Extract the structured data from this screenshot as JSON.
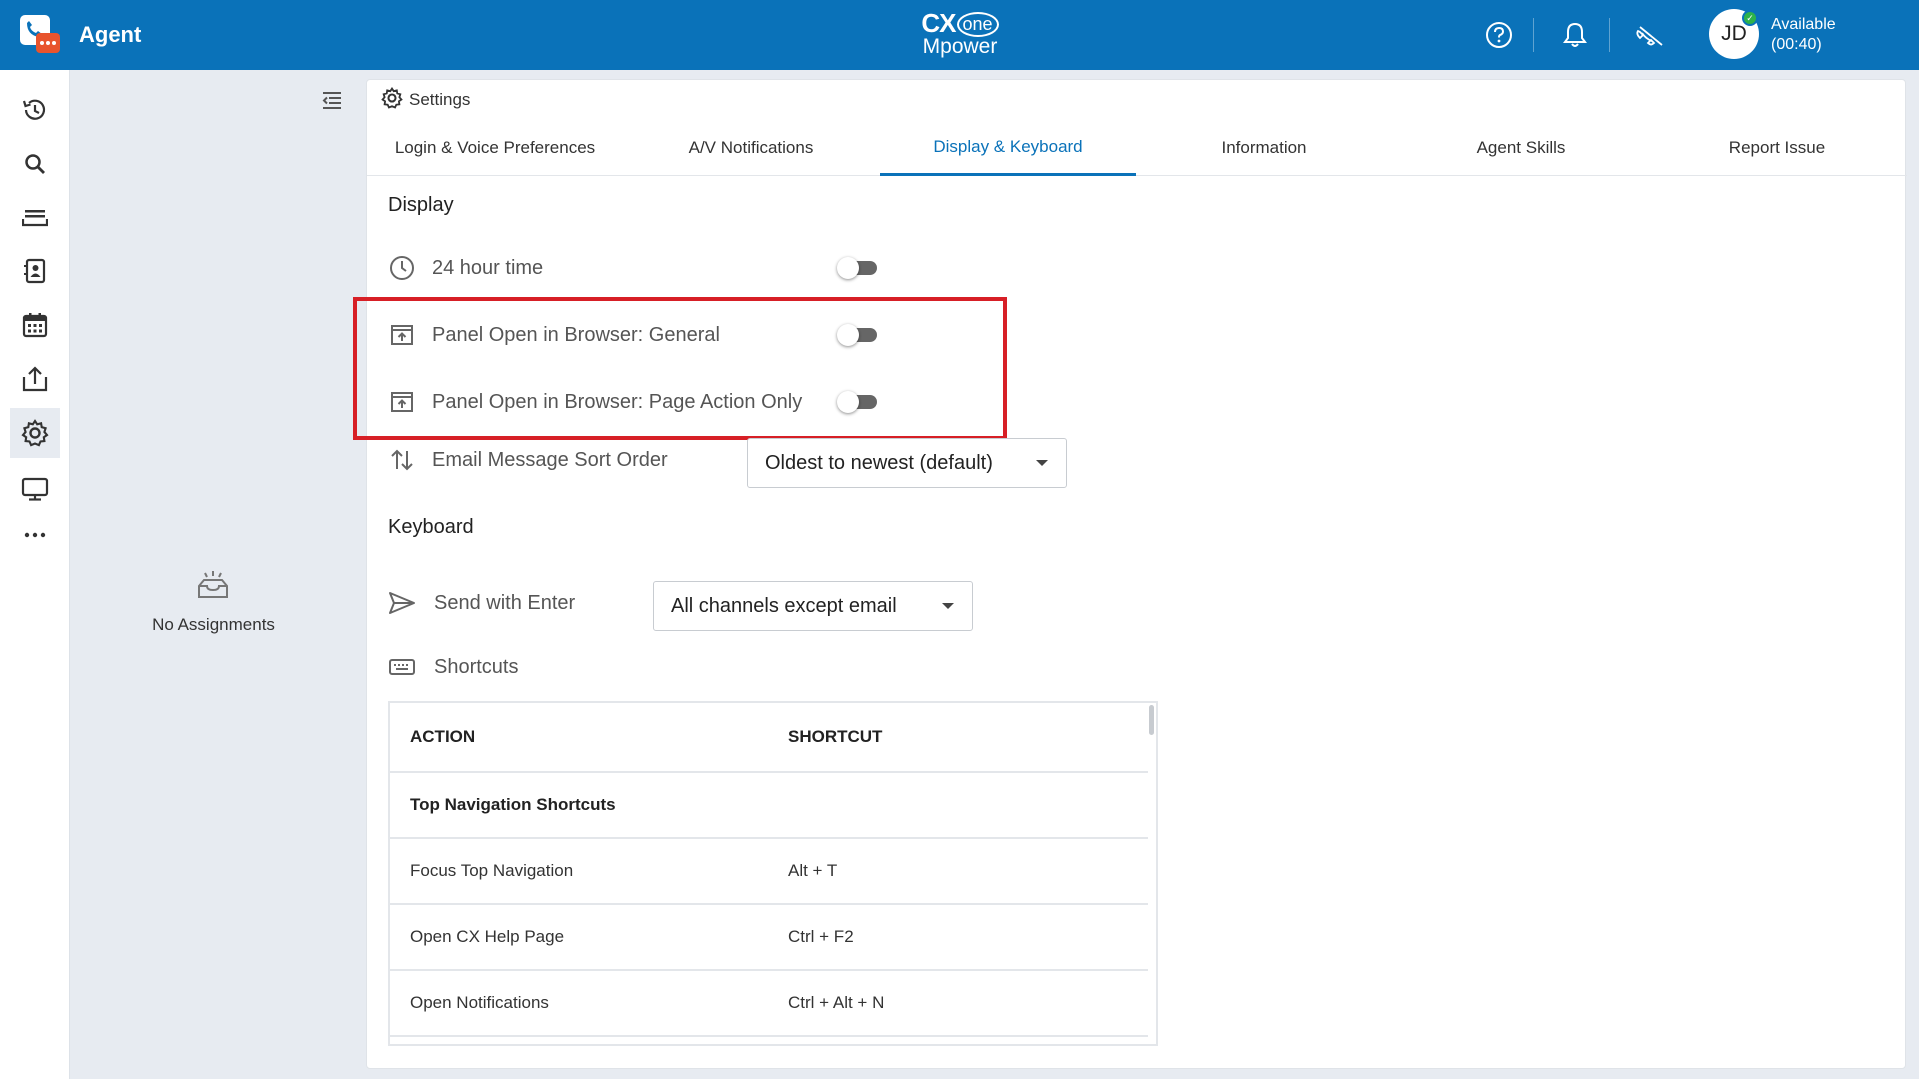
{
  "header": {
    "app_title": "Agent",
    "brand_cx": "CX",
    "brand_one": "one",
    "brand_mpower": "Mpower",
    "user_initials": "JD",
    "status_label": "Available",
    "status_timer": "(00:40)"
  },
  "assignments": {
    "empty_label": "No Assignments"
  },
  "settings": {
    "title": "Settings",
    "tabs": [
      {
        "label": "Login & Voice Preferences",
        "active": false
      },
      {
        "label": "A/V Notifications",
        "active": false
      },
      {
        "label": "Display & Keyboard",
        "active": true
      },
      {
        "label": "Information",
        "active": false
      },
      {
        "label": "Agent Skills",
        "active": false
      },
      {
        "label": "Report Issue",
        "active": false
      }
    ],
    "display": {
      "section_title": "Display",
      "hour_time_label": "24 hour time",
      "hour_time_on": false,
      "panel_general_label": "Panel Open in Browser: General",
      "panel_general_on": false,
      "panel_page_action_label": "Panel Open in Browser: Page Action Only",
      "panel_page_action_on": false,
      "email_sort_label": "Email Message Sort Order",
      "email_sort_value": "Oldest to newest (default)"
    },
    "keyboard": {
      "section_title": "Keyboard",
      "send_enter_label": "Send with Enter",
      "send_enter_value": "All channels except email",
      "shortcuts_label": "Shortcuts",
      "table": {
        "col_action": "ACTION",
        "col_shortcut": "SHORTCUT",
        "group_title": "Top Navigation Shortcuts",
        "rows": [
          {
            "action": "Focus Top Navigation",
            "shortcut": "Alt + T"
          },
          {
            "action": "Open CX Help Page",
            "shortcut": "Ctrl + F2"
          },
          {
            "action": "Open Notifications",
            "shortcut": "Ctrl + Alt + N"
          }
        ]
      }
    }
  },
  "colors": {
    "brand_blue": "#0a72b9",
    "highlight_red": "#d71f26",
    "status_green": "#2db24a"
  }
}
